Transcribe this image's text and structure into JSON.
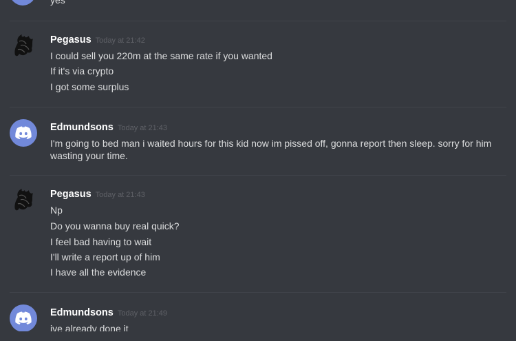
{
  "messages": [
    {
      "author": "",
      "timestamp": "",
      "lines": [
        "yes"
      ]
    },
    {
      "author": "Pegasus",
      "timestamp": "Today at 21:42",
      "lines": [
        "I could sell you 220m at the same rate if you wanted",
        "If it's via crypto",
        "I got some surplus"
      ]
    },
    {
      "author": "Edmundsons",
      "timestamp": "Today at 21:43",
      "lines": [
        "I'm going to bed man i waited hours for this kid now im pissed off, gonna report then sleep. sorry for him",
        "wasting your time."
      ]
    },
    {
      "author": "Pegasus",
      "timestamp": "Today at 21:43",
      "lines": [
        "Np",
        "Do you wanna buy real quick?",
        "I feel bad having to wait",
        "I'll write a report up of him",
        "I have all the evidence"
      ]
    },
    {
      "author": "Edmundsons",
      "timestamp": "Today at 21:49",
      "lines": [
        "ive already done it"
      ]
    }
  ],
  "icons": {
    "discord_avatar": "discord-logo-icon",
    "pegasus_avatar": "pegasus-avatar-icon"
  },
  "colors": {
    "background": "#36393f",
    "discord_blurple": "#7289da",
    "text": "#dcddde",
    "username": "#ffffff",
    "timestamp": "#5f6167"
  }
}
